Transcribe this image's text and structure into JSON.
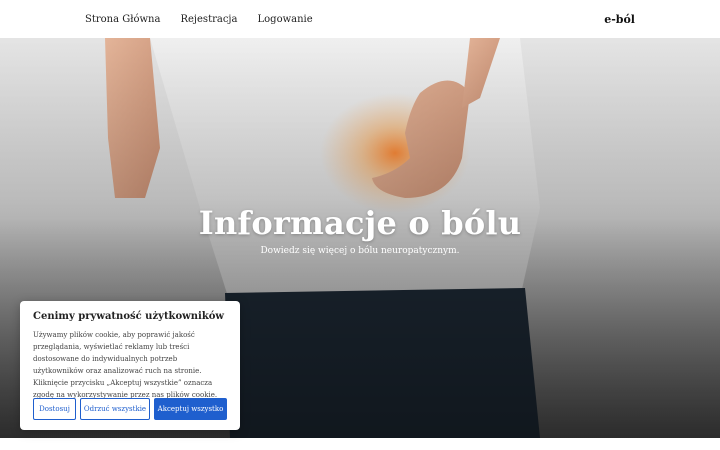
{
  "nav": {
    "links": [
      "Strona Główna",
      "Rejestracja",
      "Logowanie"
    ],
    "brand": "e-ból"
  },
  "hero": {
    "title": "Informacje o bólu",
    "subtitle": "Dowiedz się więcej o bólu neuropatycznym."
  },
  "cookie": {
    "title": "Cenimy prywatność użytkowników",
    "text": "Używamy plików cookie, aby poprawić jakość przeglądania, wyświetlać reklamy lub treści dostosowane do indywidualnych potrzeb użytkowników oraz analizować ruch na stronie. Kliknięcie przycisku „Akceptuj wszystkie” oznacza zgodę na wykorzystywanie przez nas plików cookie.",
    "buttons": {
      "customize": "Dostosuj",
      "reject": "Odrzuć wszystkie",
      "accept": "Akceptuj wszystko"
    }
  },
  "colors": {
    "accent": "#1f5fce",
    "hero_text": "#ffffff"
  }
}
